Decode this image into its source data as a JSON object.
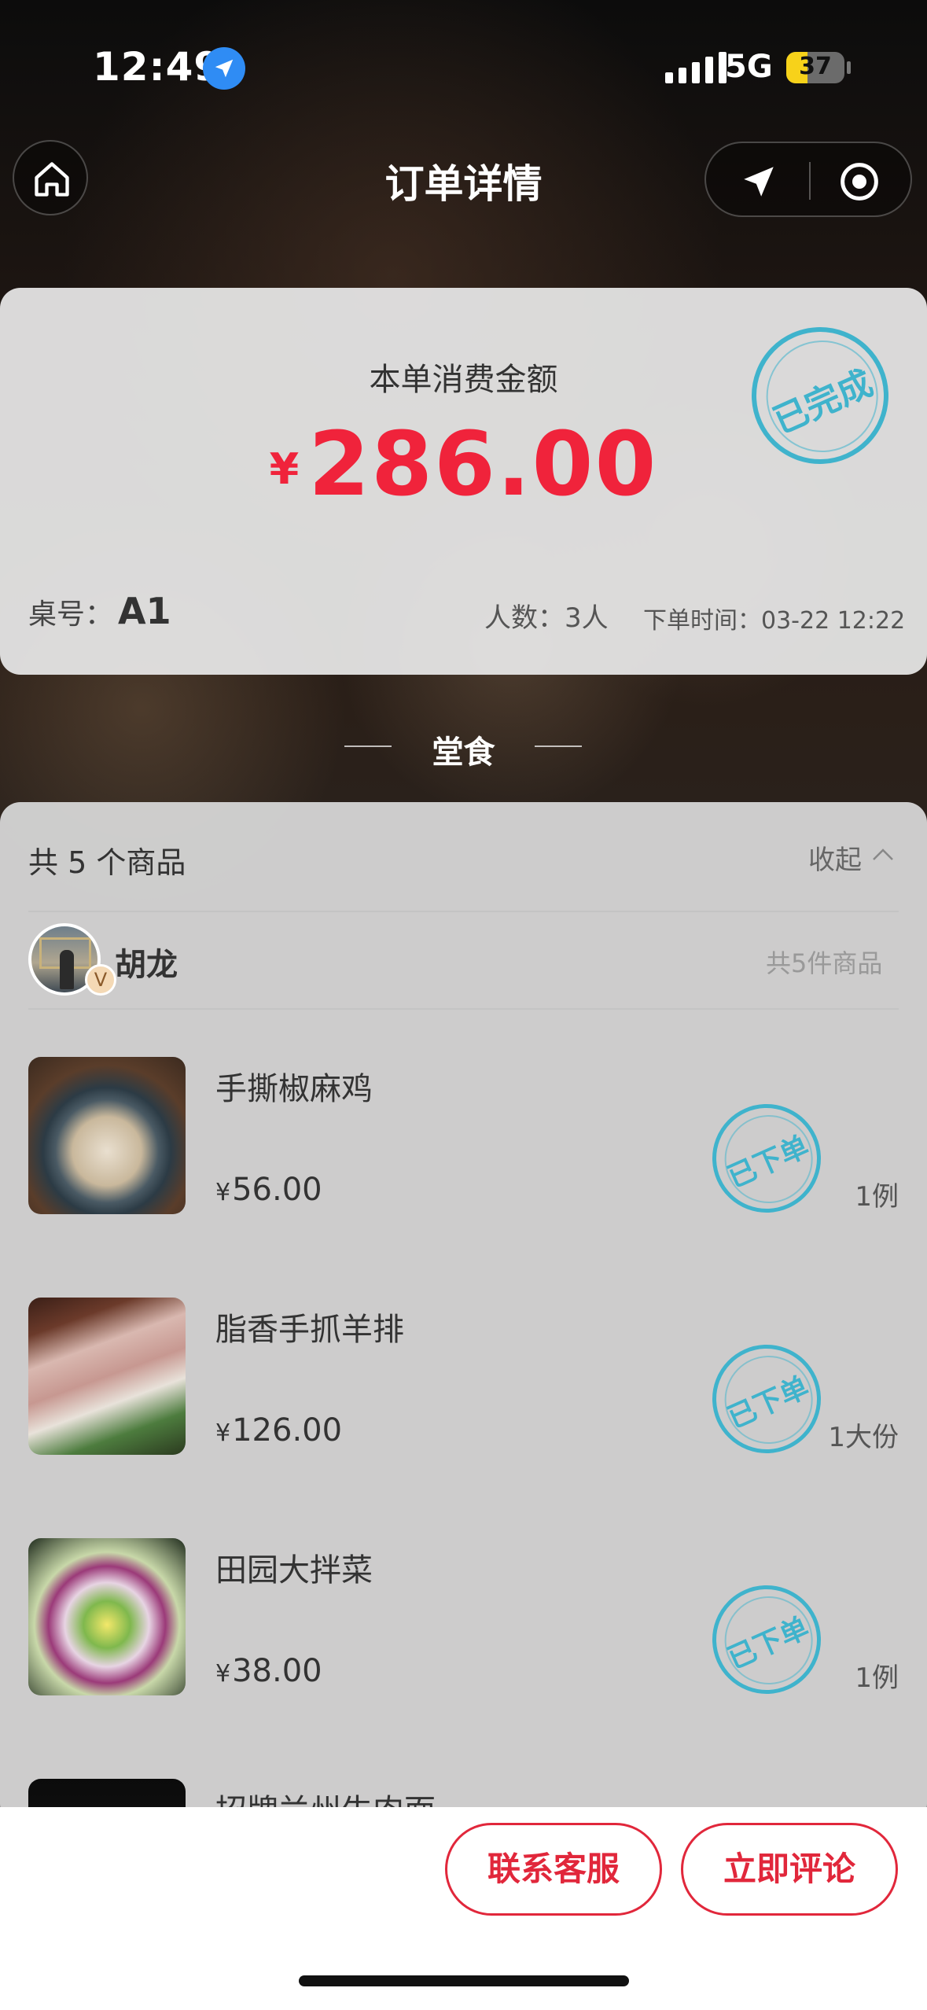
{
  "status_bar": {
    "time": "12:49",
    "network": "5G",
    "battery": "37",
    "battery_level": 0.37
  },
  "nav": {
    "title": "订单详情"
  },
  "summary": {
    "label": "本单消费金额",
    "currency": "¥",
    "amount": "286.00",
    "stamp": "已完成",
    "table_label": "桌号：",
    "table_value": "A1",
    "people": "人数：3人",
    "order_time": "下单时间：03-22 12:22"
  },
  "section": {
    "title": "堂食"
  },
  "goods": {
    "count_text": "共 5 个商品",
    "collapse_label": "收起",
    "user": {
      "name": "胡龙",
      "badge": "V",
      "total": "共5件商品"
    },
    "items": [
      {
        "name": "手撕椒麻鸡",
        "price": "56.00",
        "qty": "1例",
        "stamp": "已下单"
      },
      {
        "name": "脂香手抓羊排",
        "price": "126.00",
        "qty": "1大份",
        "stamp": "已下单"
      },
      {
        "name": "田园大拌菜",
        "price": "38.00",
        "qty": "1例",
        "stamp": "已下单"
      },
      {
        "name": "招牌兰州牛肉面"
      }
    ],
    "currency": "¥"
  },
  "bottom_bar": {
    "contact_label": "联系客服",
    "review_label": "立即评论"
  },
  "colors": {
    "accent_red": "#f0233b",
    "stamp_blue": "#3fb3cc",
    "battery_yellow": "#f7d21a"
  },
  "icons": [
    "home-icon",
    "location-arrow-icon",
    "navigation-icon",
    "target-icon",
    "chevron-up-icon",
    "signal-icon",
    "battery-icon"
  ]
}
